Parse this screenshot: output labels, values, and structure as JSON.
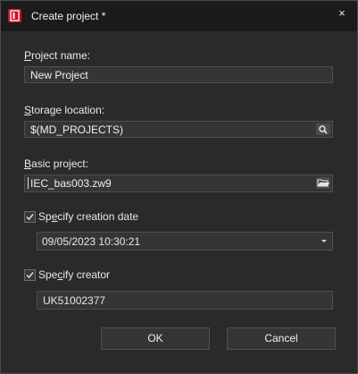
{
  "window": {
    "title": "Create project *",
    "icon": "app-icon",
    "close_glyph": "×"
  },
  "form": {
    "project_name": {
      "label_access": "P",
      "label_rest": "roject name:",
      "value": "New Project"
    },
    "storage_location": {
      "label_access": "S",
      "label_rest": "torage location:",
      "value": "$(MD_PROJECTS)",
      "button_icon": "search-icon"
    },
    "basic_project": {
      "label_access": "B",
      "label_rest": "asic project:",
      "value": "IEC_bas003.zw9",
      "button_icon": "folder-open-icon"
    },
    "creation_date": {
      "checked": true,
      "label_pre": "Sp",
      "label_access": "e",
      "label_rest": "cify creation date",
      "value": "09/05/2023 10:30:21"
    },
    "creator": {
      "checked": true,
      "label_pre": "Spe",
      "label_access": "c",
      "label_rest": "ify creator",
      "value": "UK51002377"
    }
  },
  "buttons": {
    "ok": "OK",
    "cancel": "Cancel"
  }
}
